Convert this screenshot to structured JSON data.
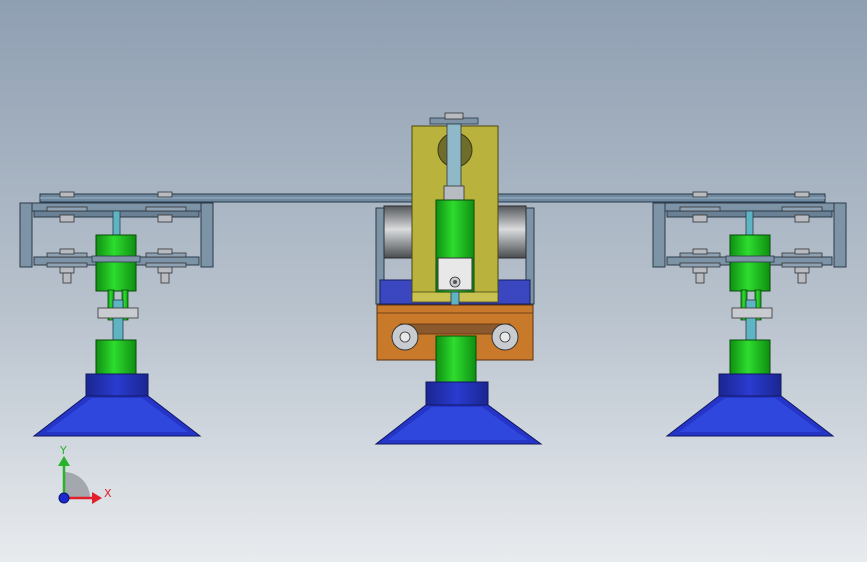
{
  "viewport": {
    "background_top": "#8f9fb2",
    "background_bottom": "#e8ebee"
  },
  "colors": {
    "plate": "#6f8aa0",
    "plate_edge": "#2a3a48",
    "frame": "#7d93a6",
    "bracket_yellow": "#b9b23c",
    "cylinder_green": "#1fc41f",
    "cup_blue": "#2535c8",
    "cup_blue_light": "#3a55ee",
    "collar_blue": "#1e2fa8",
    "block_orange": "#c87a2a",
    "bolt_gray": "#b8bcc2",
    "shaft_cyan": "#5fb4c4"
  },
  "triad": {
    "x_label": "X",
    "y_label": "Y",
    "x_color": "#e0202a",
    "y_color": "#25b42a",
    "z_color": "#1a2ad0"
  }
}
